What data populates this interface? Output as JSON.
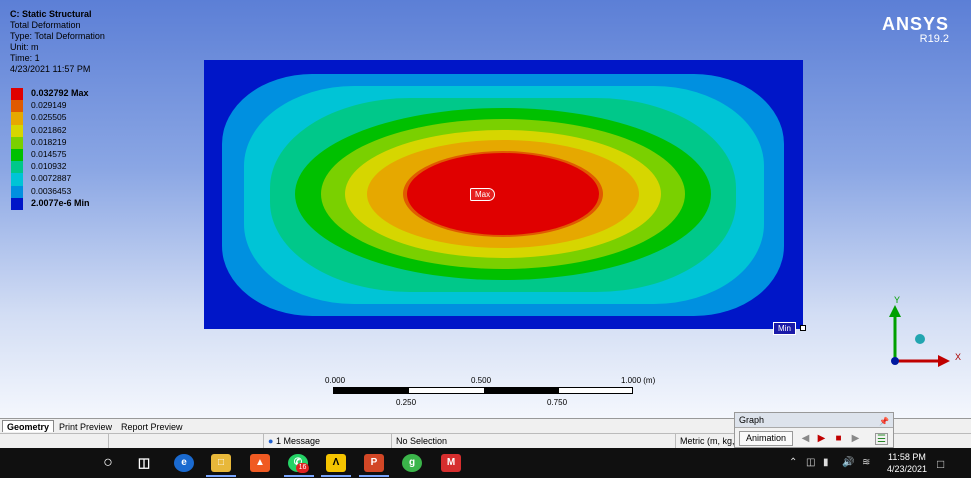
{
  "result": {
    "title": "C: Static Structural",
    "name": "Total Deformation",
    "type": "Type: Total Deformation",
    "unit": "Unit: m",
    "time": "Time: 1",
    "timestamp": "4/23/2021 11:57 PM"
  },
  "legend": {
    "items": [
      {
        "label": "0.032792 Max",
        "color": "#e00000"
      },
      {
        "label": "0.029149",
        "color": "#e05a00"
      },
      {
        "label": "0.025505",
        "color": "#e6a800"
      },
      {
        "label": "0.021862",
        "color": "#d6d600"
      },
      {
        "label": "0.018219",
        "color": "#7ad000"
      },
      {
        "label": "0.014575",
        "color": "#00c000"
      },
      {
        "label": "0.010932",
        "color": "#00c88a"
      },
      {
        "label": "0.0072887",
        "color": "#00c4d6"
      },
      {
        "label": "0.0036453",
        "color": "#0090e0"
      },
      {
        "label": "2.0077e-6 Min",
        "color": "#0016c8"
      }
    ]
  },
  "brand": {
    "name": "ANSYS",
    "version": "R19.2"
  },
  "probes": {
    "max_label": "Max",
    "min_label": "Min"
  },
  "scale": {
    "ticks_top": [
      "0.000",
      "0.500",
      "1.000 (m)"
    ],
    "ticks_bottom": [
      "0.250",
      "0.750"
    ]
  },
  "triad": {
    "x": "X",
    "y": "Y"
  },
  "tabs": [
    "Geometry",
    "Print Preview",
    "Report Preview"
  ],
  "status": {
    "messages": "1 Message",
    "selection": "No Selection",
    "units": "Metric (m, kg,"
  },
  "graph": {
    "title": "Graph",
    "animation": "Animation"
  },
  "taskbar": {
    "time": "11:58 PM",
    "date": "4/23/2021",
    "whatsapp_badge": "16"
  }
}
